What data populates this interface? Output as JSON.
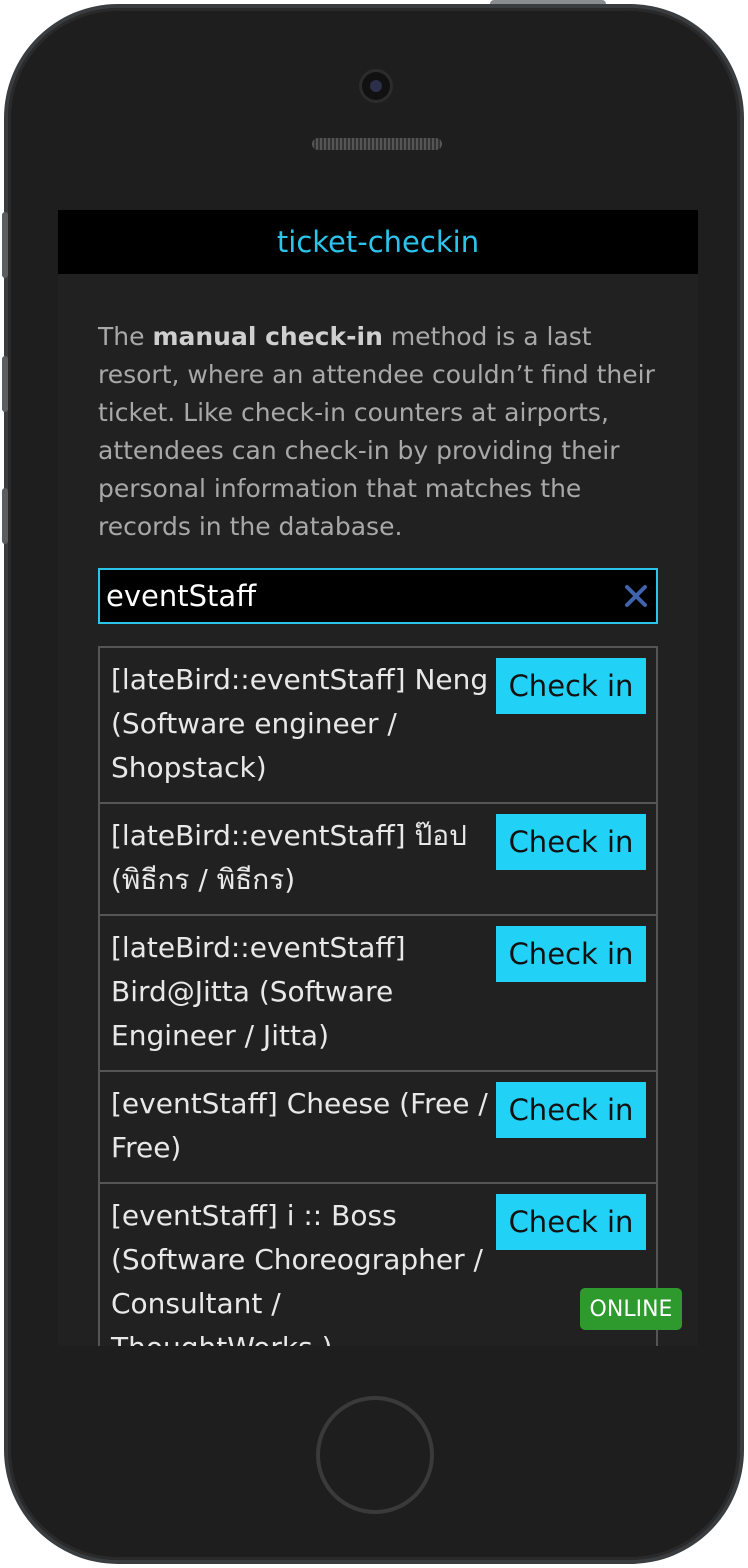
{
  "app": {
    "title": "ticket-checkin"
  },
  "intro": {
    "text_before": "The ",
    "bold": "manual check-in",
    "text_after": " method is a last resort, where an attendee couldn’t find their ticket. Like check-in counters at airports, attendees can check-in by providing their personal information that matches the records in the database."
  },
  "search": {
    "value": "eventStaff",
    "clear_icon": "close-icon"
  },
  "results": [
    {
      "text": "[lateBird::eventStaff] Neng (Software engineer / Shopstack)",
      "button": "Check in"
    },
    {
      "text": "[lateBird::eventStaff] ป๊อป (พิธีกร / พิธีกร)",
      "button": "Check in"
    },
    {
      "text": "[lateBird::eventStaff] Bird@Jitta (Software Engineer / Jitta)",
      "button": "Check in"
    },
    {
      "text": "[eventStaff] Cheese (Free / Free)",
      "button": "Check in"
    },
    {
      "text": "[eventStaff] i :: Boss (Software Choreographer / Consultant / ThoughtWorks )",
      "button": "Check in"
    }
  ],
  "status": {
    "badge": "ONLINE"
  },
  "colors": {
    "accent": "#2bc5ec",
    "button": "#22d2f6",
    "online": "#2e9a2e"
  }
}
